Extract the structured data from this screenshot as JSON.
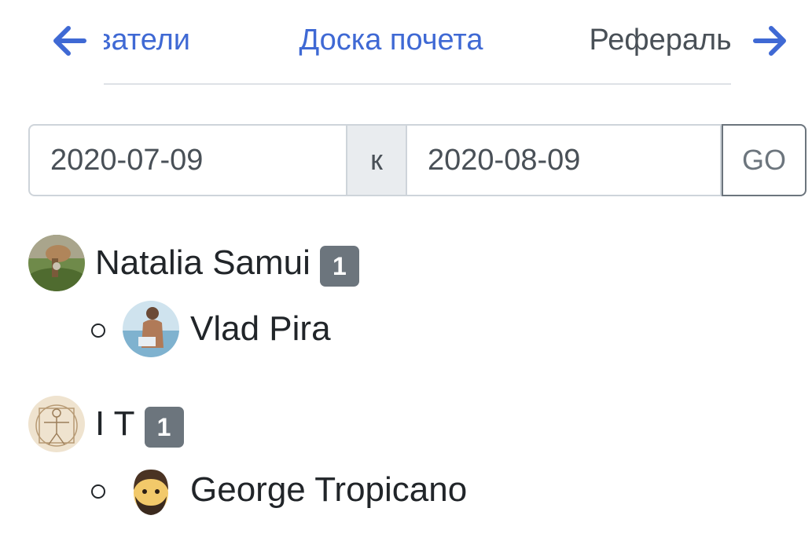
{
  "tabs": {
    "prev_icon": "arrow-left-icon",
    "next_icon": "arrow-right-icon",
    "items": [
      {
        "label": "Пользователи"
      },
      {
        "label": "Доска почета"
      },
      {
        "label": "Рефералы",
        "active": true
      }
    ]
  },
  "date_range": {
    "from": "2020-07-09",
    "separator": "к",
    "to": "2020-08-09",
    "submit_label": "GO"
  },
  "referrals": [
    {
      "name": "Natalia Samui",
      "count": "1",
      "avatar": "photo-avatar",
      "children": [
        {
          "name": "Vlad Pira",
          "avatar": "photo-avatar"
        }
      ]
    },
    {
      "name": "I T",
      "count": "1",
      "avatar": "sketch-avatar",
      "children": [
        {
          "name": "George Tropicano",
          "avatar": "emoji-avatar"
        }
      ]
    }
  ],
  "colors": {
    "accent": "#3f69d4",
    "badge": "#6c757d",
    "text": "#212529",
    "border": "#ced4da"
  }
}
